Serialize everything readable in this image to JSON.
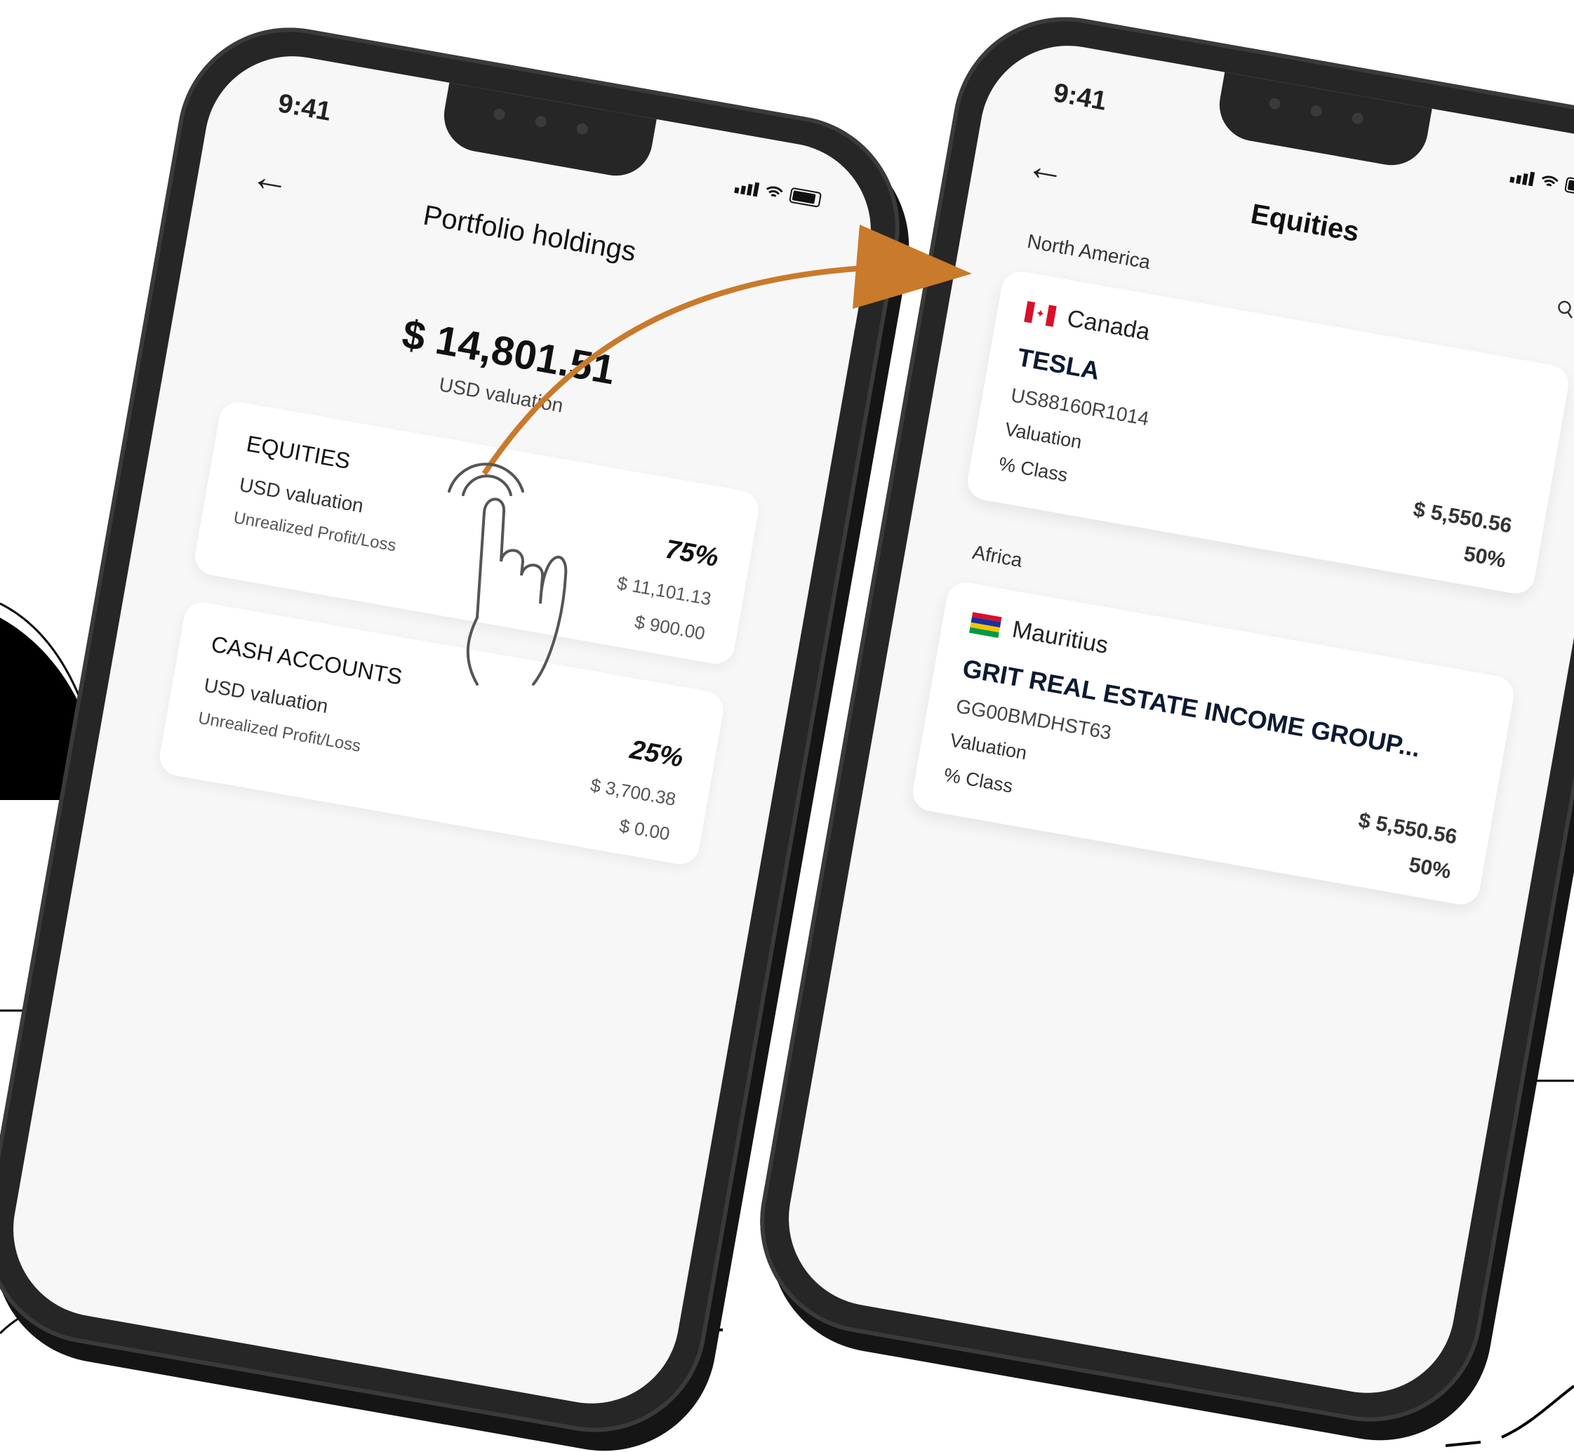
{
  "colors": {
    "arrow": "#c97a2b",
    "phone_frame": "#262626",
    "screen_bg": "#f7f7f8"
  },
  "icons": {
    "back": "back-arrow-icon",
    "search": "search-icon",
    "tap": "tap-hand-icon",
    "transition": "transition-arrow-icon"
  },
  "portfolio_screen": {
    "time": "9:41",
    "back_glyph": "←",
    "title": "Portfolio holdings",
    "total_value": "$ 14,801.51",
    "total_label": "USD valuation",
    "cards": [
      {
        "heading": "EQUITIES",
        "label_valuation": "USD valuation",
        "label_pl": "Unrealized Profit/Loss",
        "percent": "75%",
        "valuation": "$ 11,101.13",
        "profit_loss": "$ 900.00"
      },
      {
        "heading": "CASH ACCOUNTS",
        "label_valuation": "USD valuation",
        "label_pl": "Unrealized Profit/Loss",
        "percent": "25%",
        "valuation": "$ 3,700.38",
        "profit_loss": "$ 0.00"
      }
    ]
  },
  "equities_screen": {
    "time": "9:41",
    "back_glyph": "←",
    "title": "Equities",
    "groups": [
      {
        "region": "North America",
        "country": "Canada",
        "name": "TESLA",
        "isin": "US88160R1014",
        "label_valuation": "Valuation",
        "label_class": "% Class",
        "valuation": "$ 5,550.56",
        "class_percent": "50%"
      },
      {
        "region": "Africa",
        "country": "Mauritius",
        "name": "GRIT REAL ESTATE INCOME GROUP...",
        "isin": "GG00BMDHST63",
        "label_valuation": "Valuation",
        "label_class": "% Class",
        "valuation": "$ 5,550.56",
        "class_percent": "50%"
      }
    ]
  }
}
